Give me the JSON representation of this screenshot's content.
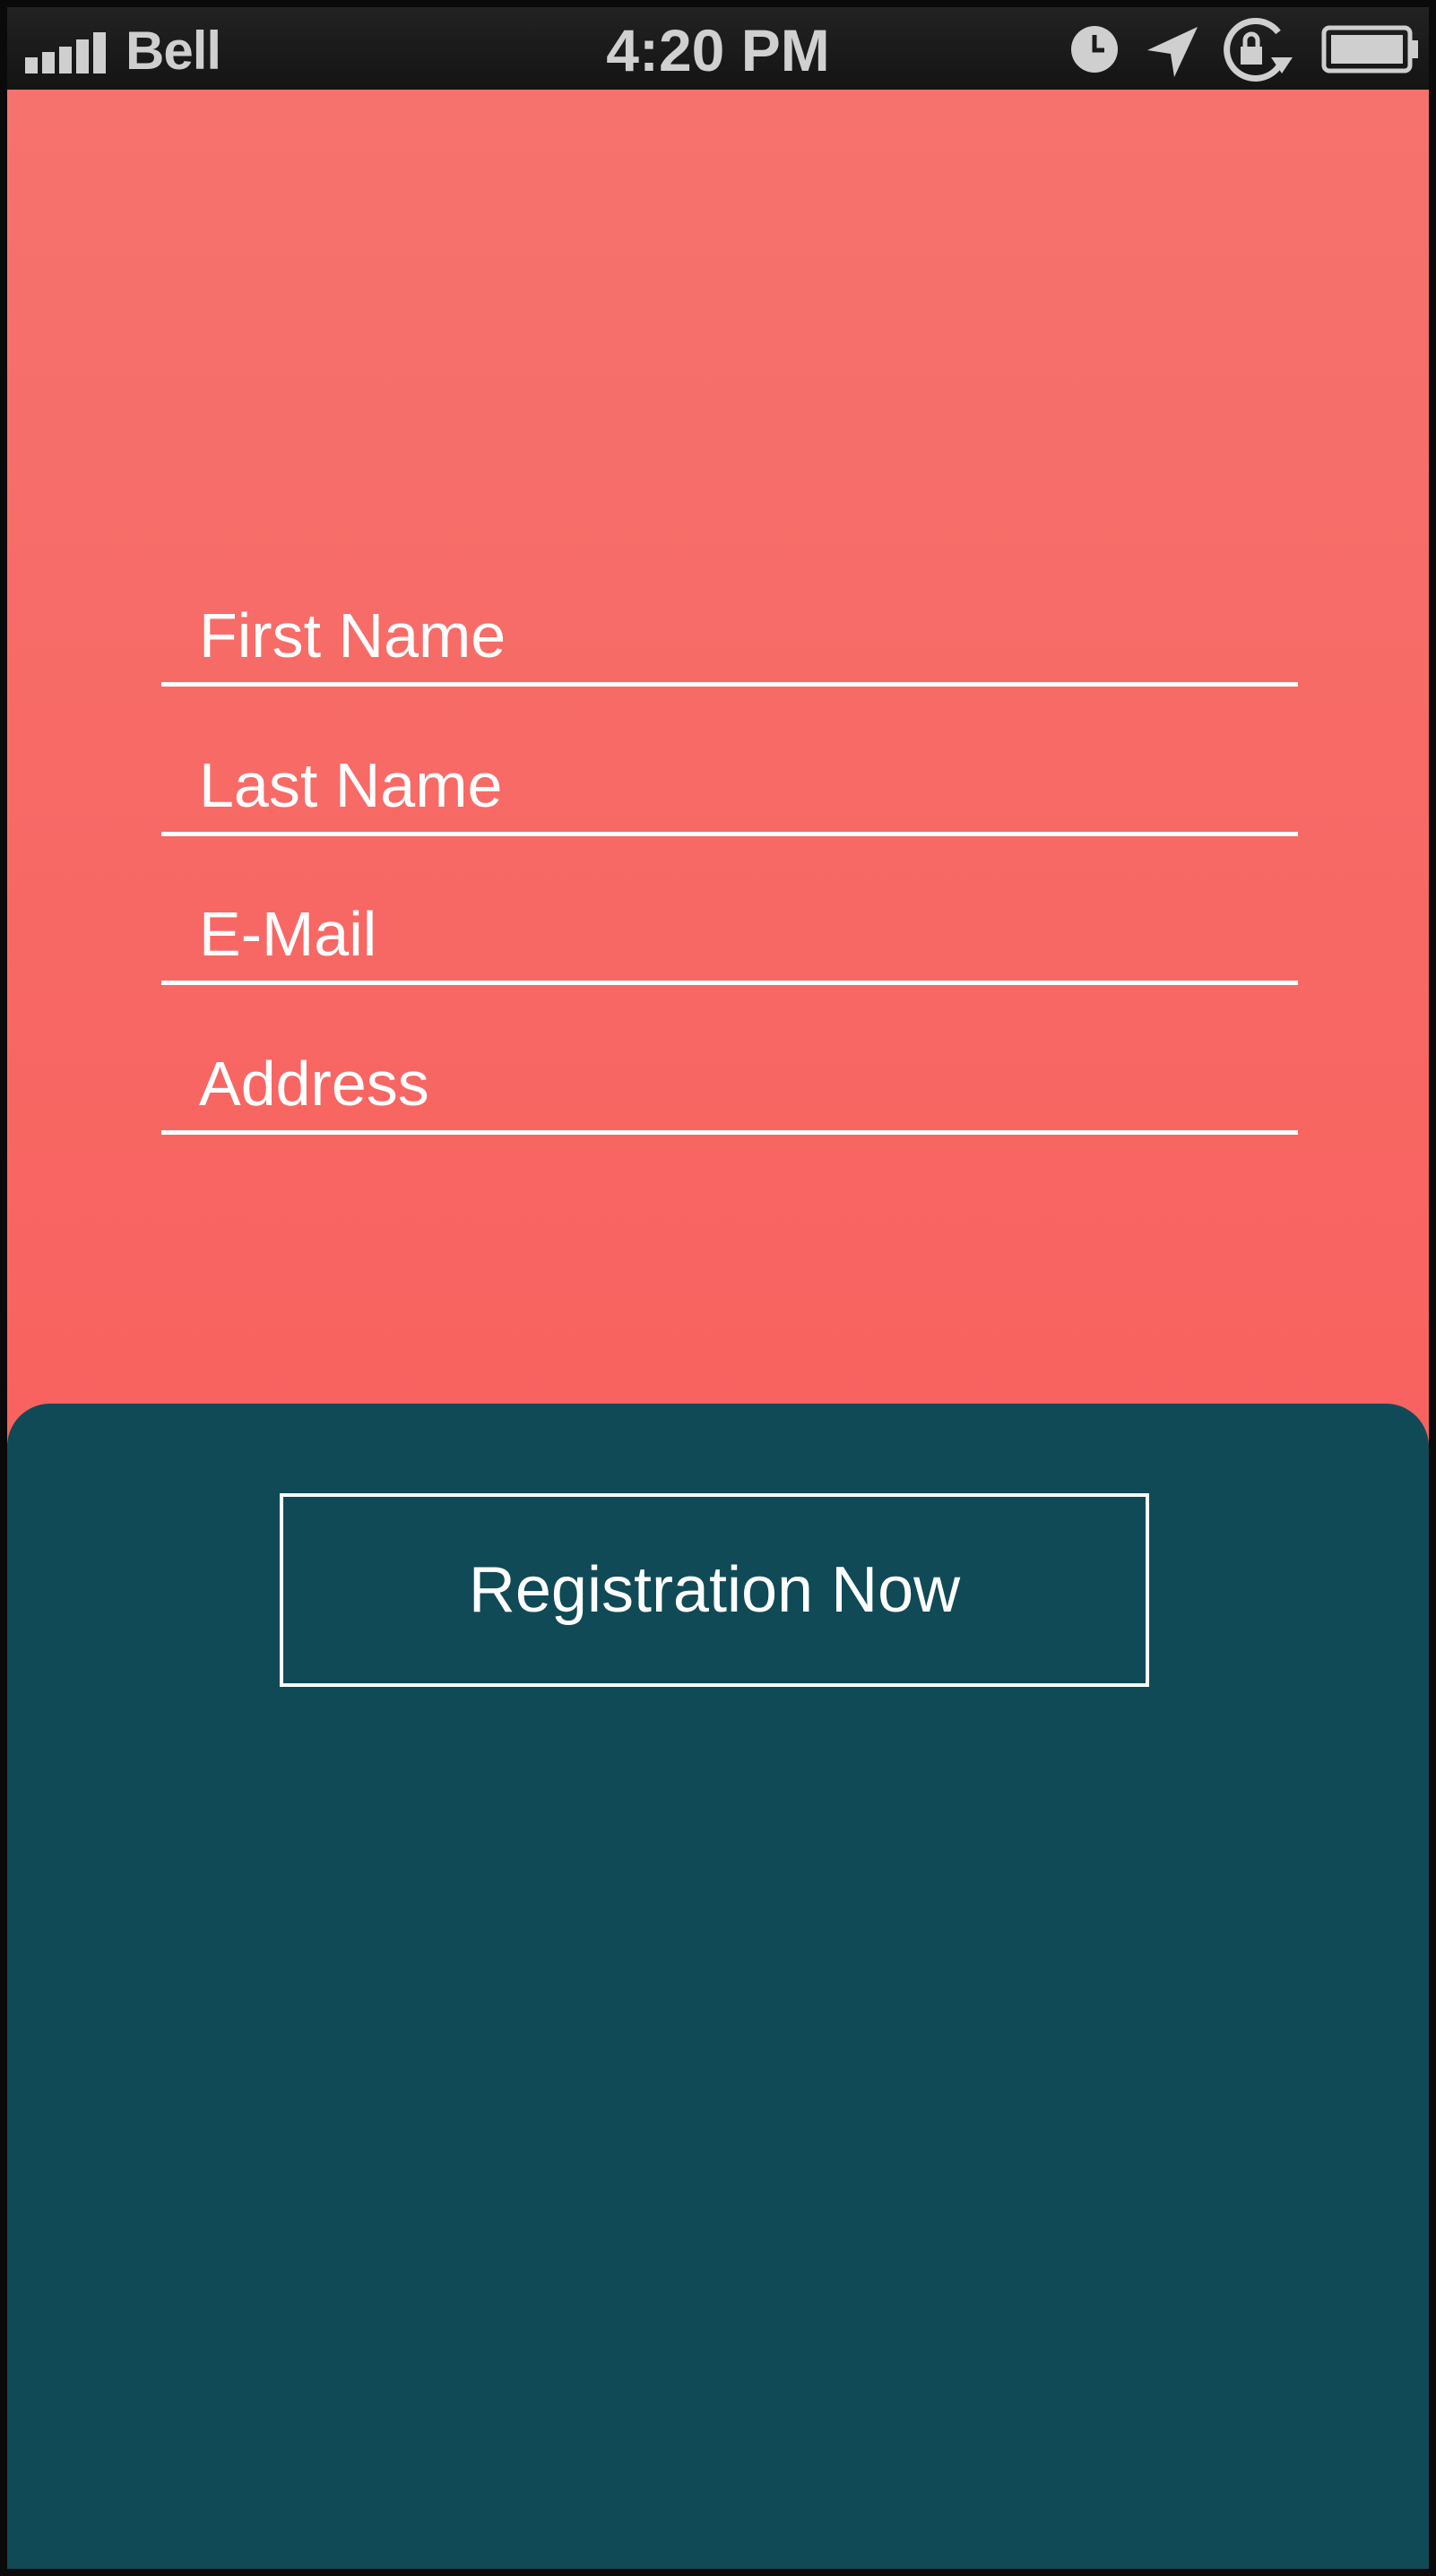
{
  "status_bar": {
    "carrier": "Bell",
    "time": "4:20 PM",
    "icons": [
      "signal-bars-icon",
      "alarm-clock-icon",
      "location-arrow-icon",
      "rotation-lock-icon",
      "battery-icon"
    ]
  },
  "form": {
    "fields": [
      {
        "placeholder": "First Name",
        "value": ""
      },
      {
        "placeholder": "Last Name",
        "value": ""
      },
      {
        "placeholder": "E-Mail",
        "value": ""
      },
      {
        "placeholder": "Address",
        "value": ""
      }
    ],
    "submit_label": "Registration Now"
  },
  "colors": {
    "top_panel": "#f6726d",
    "bottom_panel": "#104a57",
    "status_bar": "#1a1a1a",
    "text": "#ffffff"
  }
}
